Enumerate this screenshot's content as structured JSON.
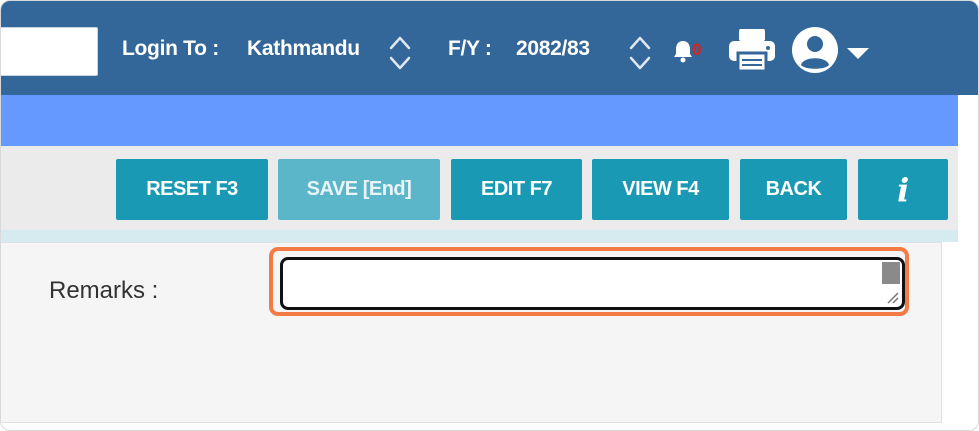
{
  "header": {
    "login_label": "Login To :",
    "login_value": "Kathmandu",
    "fy_label": "F/Y :",
    "fy_value": "2082/83",
    "notification_count": "0",
    "icons": [
      "chevron-updown-icon",
      "bell-icon",
      "printer-icon",
      "user-circle-icon",
      "caret-down-icon"
    ]
  },
  "toolbar": {
    "buttons": [
      {
        "label": "RESET F3",
        "enabled": true
      },
      {
        "label": "SAVE [End]",
        "enabled": false
      },
      {
        "label": "EDIT F7",
        "enabled": true
      },
      {
        "label": "VIEW F4",
        "enabled": true
      },
      {
        "label": "BACK",
        "enabled": true
      },
      {
        "label": "i",
        "enabled": true
      }
    ]
  },
  "form": {
    "remarks_label": "Remarks :",
    "remarks_value": ""
  },
  "colors": {
    "header": "#336699",
    "subbar": "#6699ff",
    "button": "#1999b3",
    "button_disabled": "#5cb6c9",
    "highlight": "#f47b45"
  }
}
